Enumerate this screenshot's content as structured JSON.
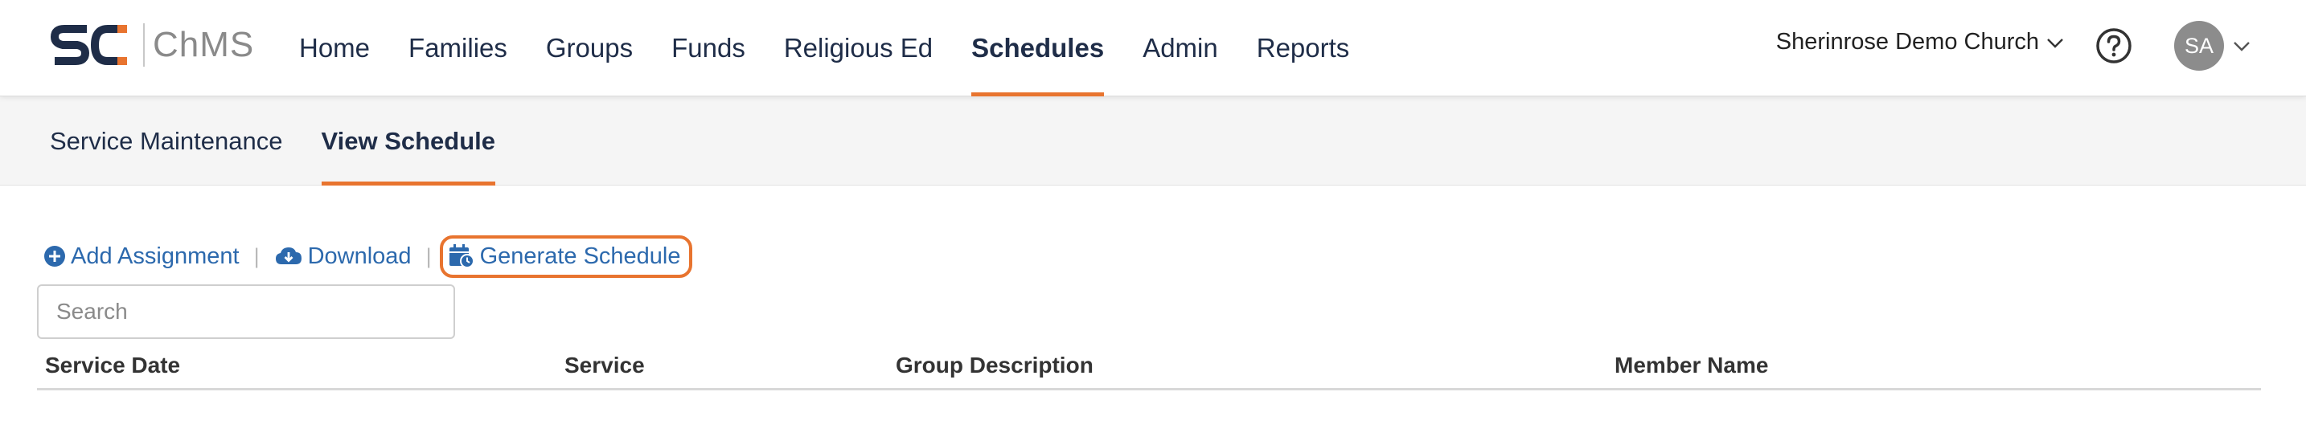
{
  "brand": {
    "logo_text": "ChMS",
    "mark_color": "#1f2d48",
    "accent_color": "#e8742f"
  },
  "main_nav": [
    {
      "label": "Home",
      "active": false
    },
    {
      "label": "Families",
      "active": false
    },
    {
      "label": "Groups",
      "active": false
    },
    {
      "label": "Funds",
      "active": false
    },
    {
      "label": "Religious Ed",
      "active": false
    },
    {
      "label": "Schedules",
      "active": true
    },
    {
      "label": "Admin",
      "active": false
    },
    {
      "label": "Reports",
      "active": false
    }
  ],
  "header": {
    "organization": "Sherinrose Demo Church",
    "help_icon": "question-circle-icon",
    "avatar_initials": "SA"
  },
  "sub_nav": [
    {
      "label": "Service Maintenance",
      "active": false
    },
    {
      "label": "View Schedule",
      "active": true
    }
  ],
  "actions": {
    "add_assignment": "Add Assignment",
    "download": "Download",
    "generate_schedule": "Generate Schedule",
    "separator": "|",
    "icons": [
      "plus-circle-icon",
      "cloud-download-icon",
      "calendar-clock-icon"
    ],
    "link_color": "#2c69ad"
  },
  "search": {
    "placeholder": "Search",
    "value": ""
  },
  "table": {
    "columns": [
      "Service Date",
      "Service",
      "Group Description",
      "Member Name"
    ],
    "rows": []
  }
}
